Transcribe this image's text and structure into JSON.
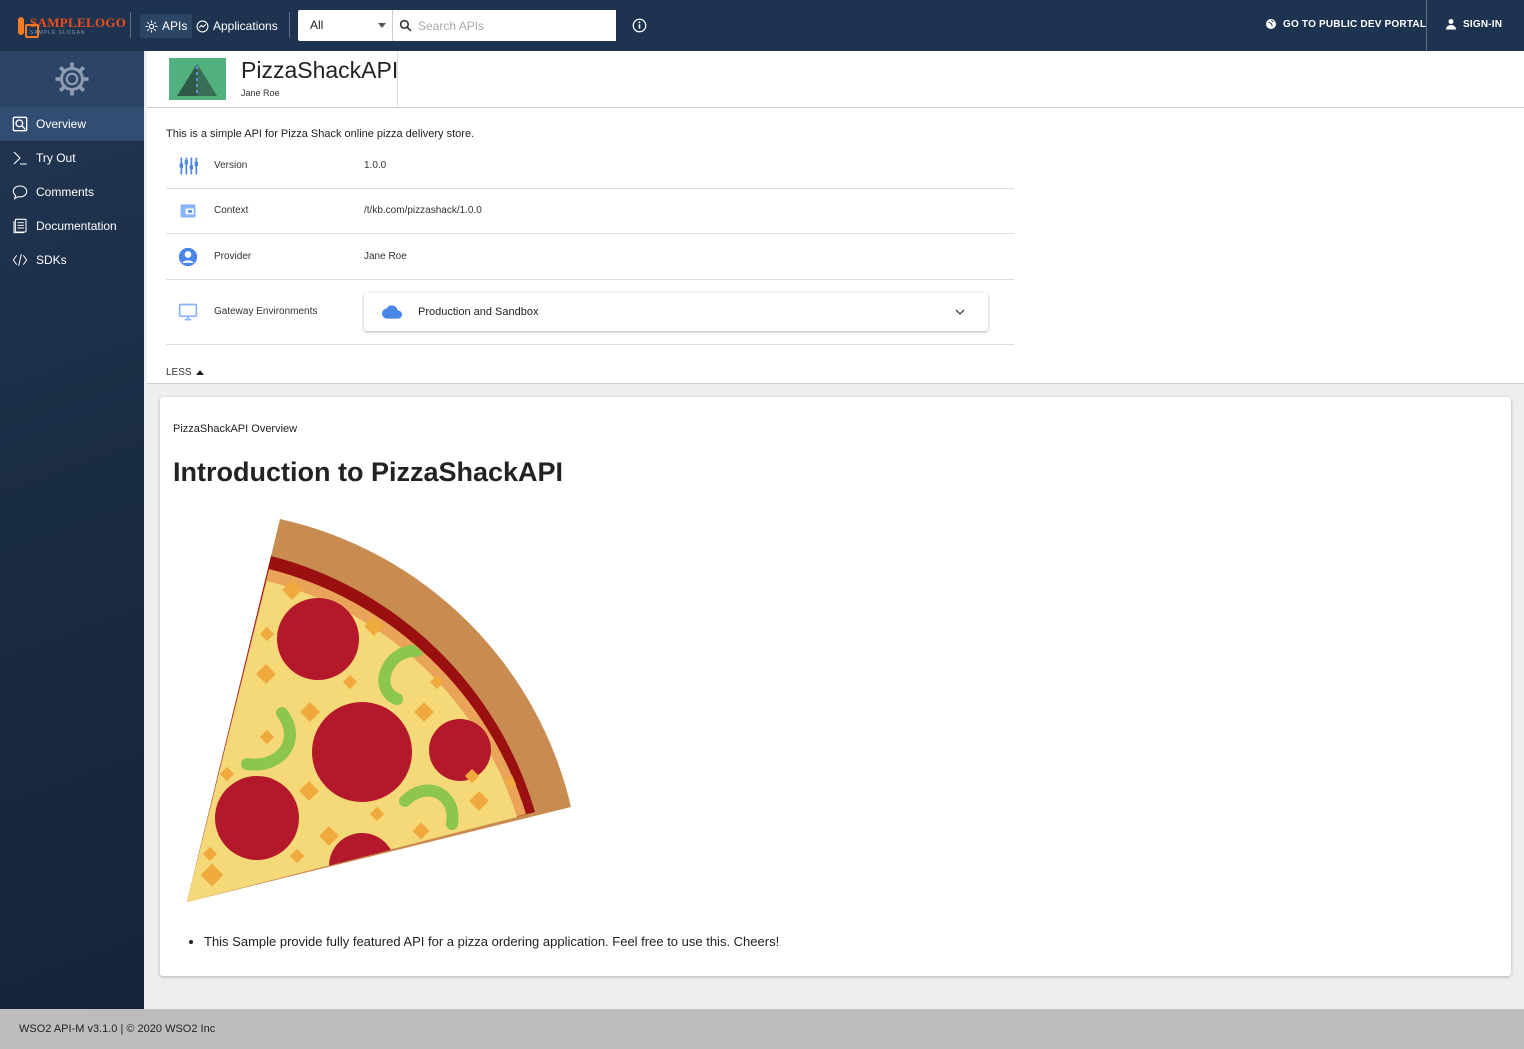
{
  "topbar": {
    "logo": {
      "main": "SAMPLELOGO",
      "slogan": "SAMPLE SLOGAN"
    },
    "nav": [
      {
        "label": "APIs",
        "icon": "gear-icon",
        "active": true
      },
      {
        "label": "Applications",
        "icon": "applications-icon",
        "active": false
      }
    ],
    "filter_selected": "All",
    "search_placeholder": "Search APIs",
    "public_portal_label": "GO TO PUBLIC DEV PORTAL",
    "signin_label": "SIGN-IN"
  },
  "sidebar": {
    "items": [
      {
        "label": "Overview",
        "icon": "overview-icon",
        "active": true
      },
      {
        "label": "Try Out",
        "icon": "terminal-icon",
        "active": false
      },
      {
        "label": "Comments",
        "icon": "comment-icon",
        "active": false
      },
      {
        "label": "Documentation",
        "icon": "document-icon",
        "active": false
      },
      {
        "label": "SDKs",
        "icon": "code-icon",
        "active": false
      }
    ]
  },
  "api": {
    "name": "PizzaShackAPI",
    "owner": "Jane Roe",
    "description": "This is a simple API for Pizza Shack online pizza delivery store.",
    "details": [
      {
        "label": "Version",
        "value": "1.0.0",
        "icon": "version-icon"
      },
      {
        "label": "Context",
        "value": "/t/kb.com/pizzashack/1.0.0",
        "icon": "context-icon"
      },
      {
        "label": "Provider",
        "value": "Jane Roe",
        "icon": "provider-icon"
      }
    ],
    "gateway": {
      "label": "Gateway Environments",
      "selected": "Production and Sandbox"
    },
    "less_label": "LESS"
  },
  "overview": {
    "label": "PizzaShackAPI Overview",
    "heading": "Introduction to PizzaShackAPI",
    "bullets": [
      "This Sample provide fully featured API for a pizza ordering application. Feel free to use this. Cheers!"
    ]
  },
  "footer": {
    "text": "WSO2 API-M v3.1.0 | © 2020 WSO2 Inc"
  },
  "colors": {
    "topbar": "#1e3350",
    "sidebar": "#1b2c45",
    "accent": "#4a86e8"
  }
}
